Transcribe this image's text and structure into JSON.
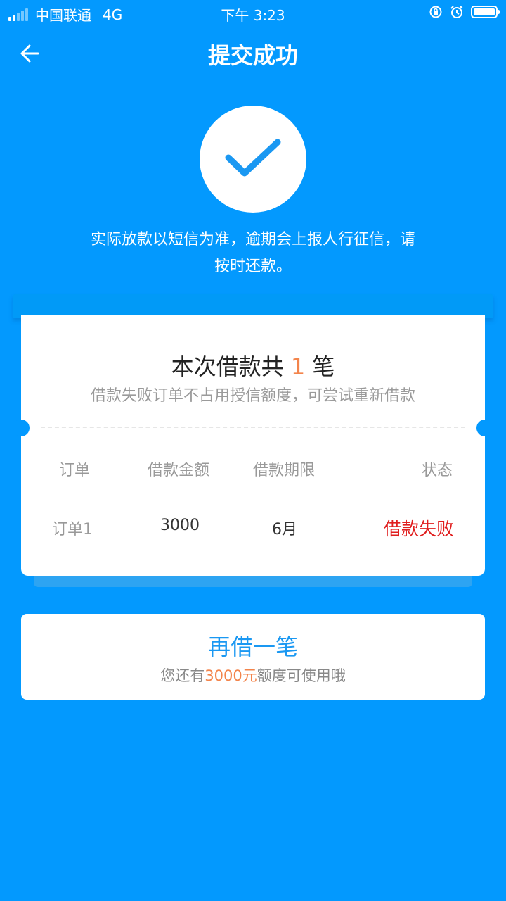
{
  "status_bar": {
    "carrier": "中国联通",
    "network": "4G",
    "time": "下午 3:23",
    "battery_level": 1.0
  },
  "nav": {
    "title": "提交成功",
    "back_icon": "arrow-left-icon"
  },
  "success": {
    "icon": "checkmark-icon",
    "notice_line1": "实际放款以短信为准，逾期会上报人行征信，请",
    "notice_line2": "按时还款。"
  },
  "summary": {
    "title_prefix": "本次借款共",
    "count": "1",
    "title_suffix": "笔",
    "subtitle": "借款失败订单不占用授信额度，可尝试重新借款"
  },
  "table": {
    "headers": [
      "订单",
      "借款金额",
      "借款期限",
      "状态"
    ],
    "rows": [
      {
        "order": "订单1",
        "amount": "3000",
        "term": "6月",
        "status": "借款失败"
      }
    ]
  },
  "borrow_again": {
    "label": "再借一笔",
    "sub_prefix": "您还有",
    "sub_amount": "3000元",
    "sub_suffix": "额度可使用哦"
  },
  "colors": {
    "background": "#0399FE",
    "accent": "#1A98F2",
    "highlight": "#F3844B",
    "fail": "#E01E1E"
  }
}
